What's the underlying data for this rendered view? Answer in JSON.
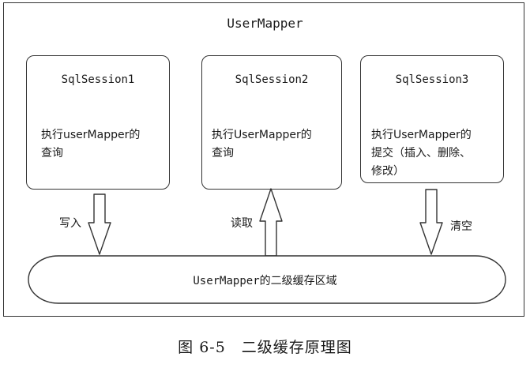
{
  "diagram": {
    "title": "UserMapper",
    "sessions": [
      {
        "name": "SqlSession1",
        "desc": "执行userMapper的\n查询"
      },
      {
        "name": "SqlSession2",
        "desc": "执行UserMapper的\n查询"
      },
      {
        "name": "SqlSession3",
        "desc": "执行UserMapper的\n提交（插入、删除、\n修改）"
      }
    ],
    "arrows": [
      {
        "label": "写入",
        "direction": "down"
      },
      {
        "label": "读取",
        "direction": "up"
      },
      {
        "label": "清空",
        "direction": "down"
      }
    ],
    "cache_label": "UserMapper的二级缓存区域"
  },
  "caption": "图 6-5　二级缓存原理图"
}
